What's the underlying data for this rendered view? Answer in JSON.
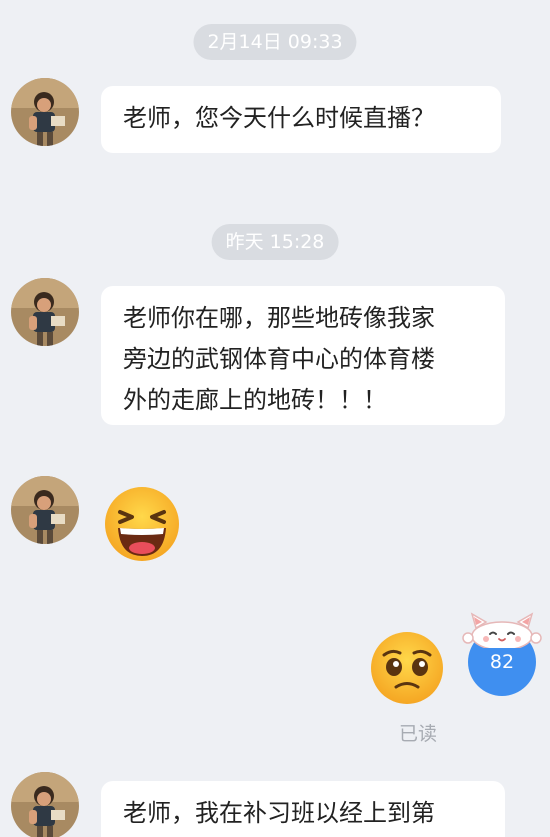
{
  "messages": {
    "ts1": "2月14日 09:33",
    "msg1": "老师，您今天什么时候直播？",
    "ts2": "昨天 15:28",
    "msg2_line1": "老师你在哪，那些地砖像我家",
    "msg2_line2": "旁边的武钢体育中心的体育楼",
    "msg2_line3": "外的走廊上的地砖！！！",
    "msg4": "老师，我在补习班以经上到第"
  },
  "status": {
    "read": "已读"
  },
  "badge": {
    "count": "82"
  },
  "icons": {
    "laugh": "laughing-emoji",
    "sad": "pleading-emoji",
    "cat": "lucky-cat-icon"
  },
  "colors": {
    "background": "#eef0f4",
    "bubble": "#ffffff",
    "timestamp_bg": "#d9dce1",
    "badge": "#3f8ff0"
  }
}
